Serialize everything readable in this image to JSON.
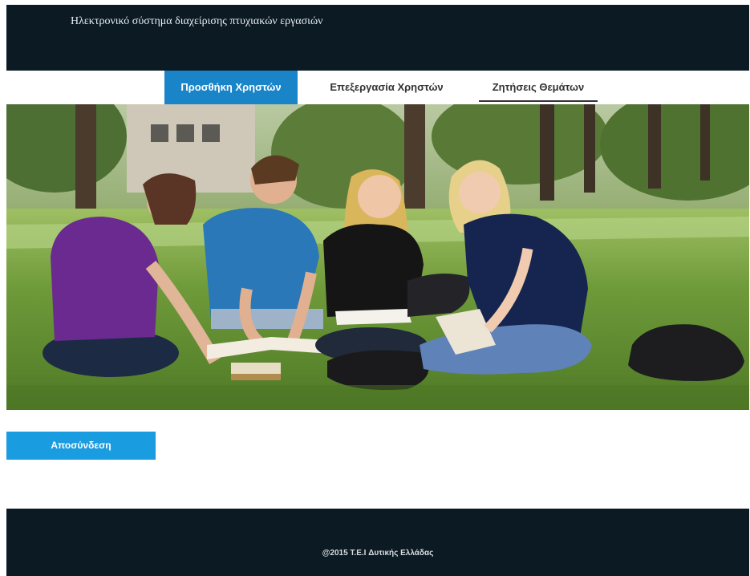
{
  "header": {
    "title": "Ηλεκτρονικό σύστημα διαχείρισης πτυχιακών εργασιών"
  },
  "nav": {
    "items": [
      {
        "label": "Προσθήκη Χρηστών",
        "active": true
      },
      {
        "label": "Επεξεργασία Χρηστών",
        "active": false
      },
      {
        "label": "Ζητήσεις Θεμάτων",
        "active": false
      }
    ]
  },
  "hero": {
    "image": "students-studying-on-grass-photo"
  },
  "actions": {
    "logout_label": "Αποσύνδεση"
  },
  "footer": {
    "copyright": "@2015 T.E.I Δυτικής Ελλάδας"
  },
  "colors": {
    "header_bg": "#0c1a24",
    "accent": "#1a84c9",
    "button": "#1a9ce0"
  }
}
